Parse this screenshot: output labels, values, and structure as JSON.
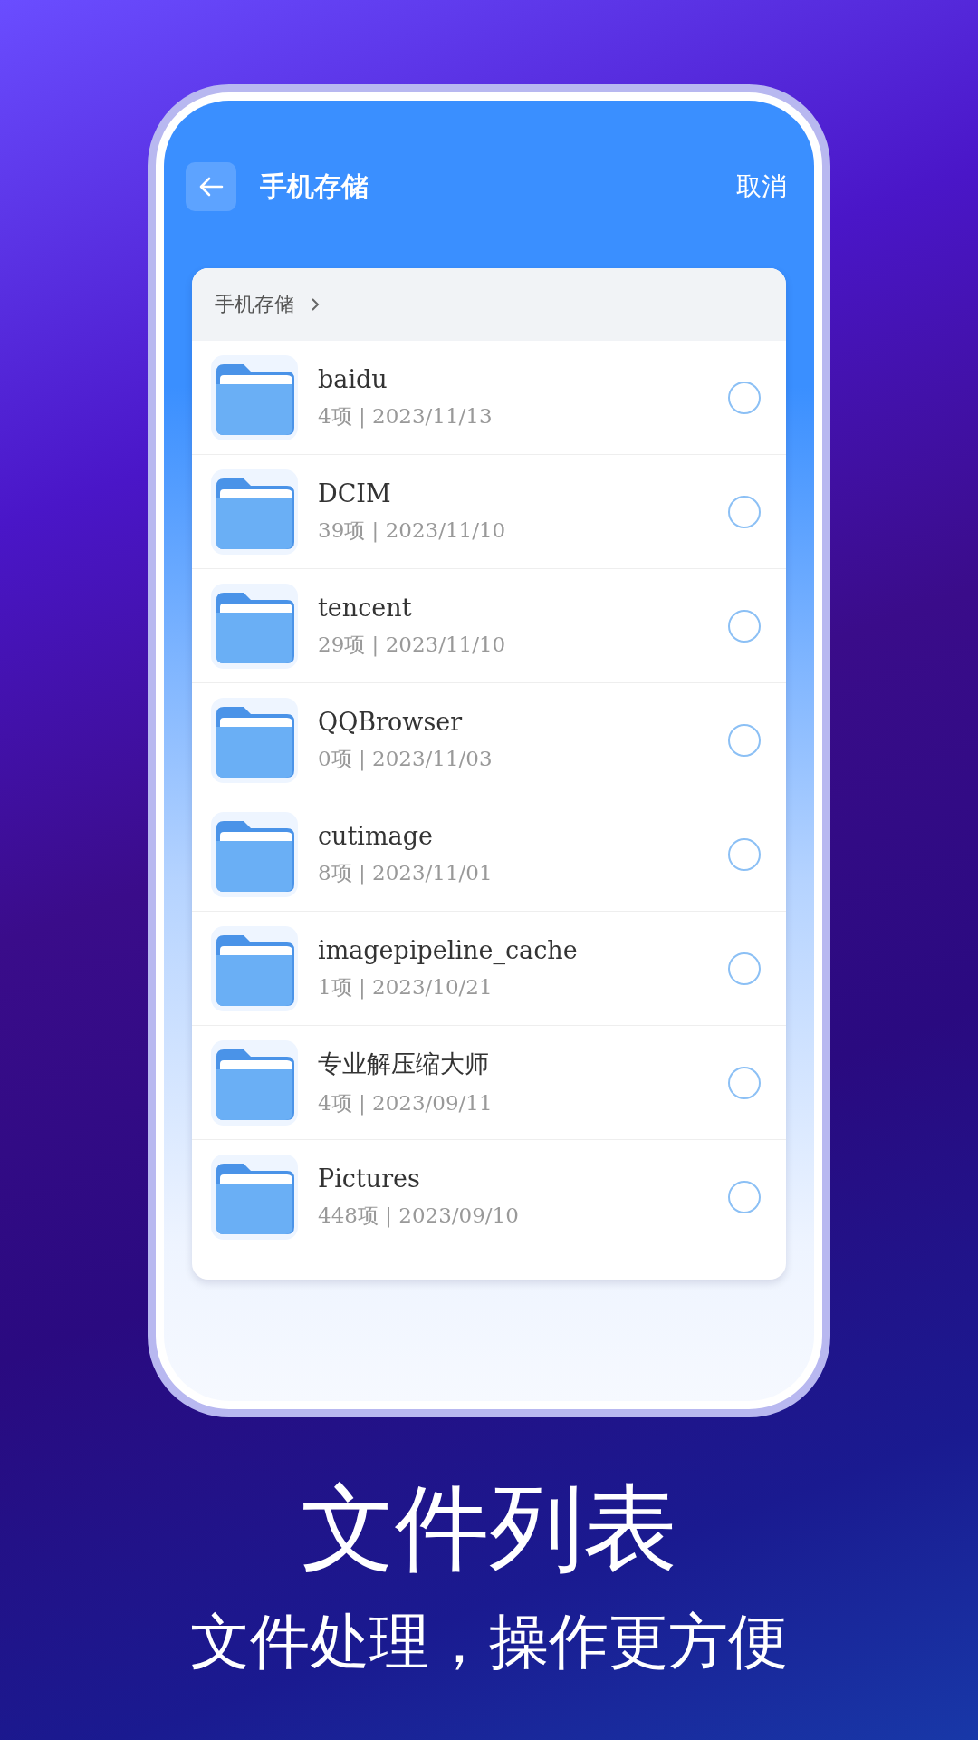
{
  "header": {
    "title": "手机存储",
    "cancel": "取消"
  },
  "breadcrumb": {
    "path": "手机存储"
  },
  "files": [
    {
      "name": "baidu",
      "meta": "4项 | 2023/11/13",
      "selected": false
    },
    {
      "name": "DCIM",
      "meta": "39项 | 2023/11/10",
      "selected": false
    },
    {
      "name": "tencent",
      "meta": "29项 | 2023/11/10",
      "selected": false
    },
    {
      "name": "QQBrowser",
      "meta": "0项 | 2023/11/03",
      "selected": false
    },
    {
      "name": "cutimage",
      "meta": "8项 | 2023/11/01",
      "selected": false
    },
    {
      "name": "imagepipeline_cache",
      "meta": "1项 | 2023/10/21",
      "selected": false
    },
    {
      "name": "专业解压缩大师",
      "meta": "4项 | 2023/09/11",
      "selected": false
    },
    {
      "name": "Pictures",
      "meta": "448项 | 2023/09/10",
      "selected": false
    }
  ],
  "caption": {
    "title": "文件列表",
    "subtitle": "文件处理，操作更方便"
  }
}
